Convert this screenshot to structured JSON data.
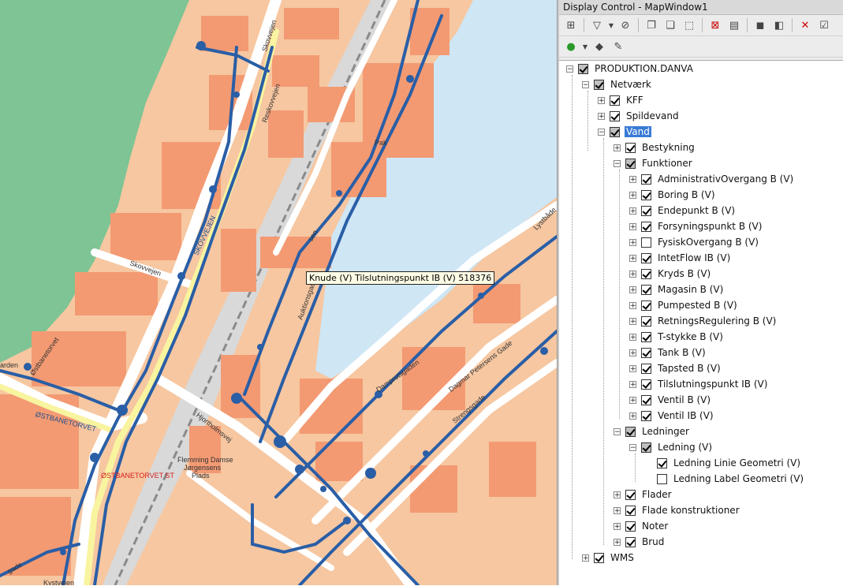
{
  "window": {
    "title": "Display Control - MapWindow1"
  },
  "colors": {
    "water": "#cfe6f5",
    "park": "#7ec494",
    "building": "#f39a73",
    "road": "#ffffff",
    "highway": "#f8f4a0",
    "pipe": "#2a5ea6",
    "rail": "#d9d9d9",
    "select": "#3a7bd5"
  },
  "toolbar": {
    "row1": [
      "tree-layout-icon",
      "filter-icon",
      "filter-dropdown-icon",
      "filter-clear-icon",
      "copy-layer-icon",
      "paste-layer-icon",
      "select-layer-icon",
      "zoom-extent-icon",
      "properties-icon",
      "group-icon",
      "ungroup-icon",
      "remove-layer-icon",
      "settings-icon"
    ],
    "row2": [
      "add-layer-icon",
      "add-dropdown-icon",
      "layer-style-icon",
      "edit-layer-icon"
    ]
  },
  "map": {
    "tooltip": "Knude (V) Tilslutningspunkt IB (V) 518376",
    "labels": [
      {
        "id": "skovvejen1",
        "text": "Skovvejen"
      },
      {
        "id": "reskovvejen",
        "text": "Reskovvejen"
      },
      {
        "id": "skovvejen2",
        "text": "SKOVVEJEN"
      },
      {
        "id": "skovvejen3",
        "text": "Skovvejen"
      },
      {
        "id": "ostbanetorvet1",
        "text": "Østbanetorvet"
      },
      {
        "id": "ostbanetorvet2",
        "text": "ØSTBANETORVET"
      },
      {
        "id": "ostbanetorvetst",
        "text": "ØSTBANETORVET ST"
      },
      {
        "id": "hjortholmsvej",
        "text": "Hjortholmsvej"
      },
      {
        "id": "auktionsgaden",
        "text": "Auktionsgaden"
      },
      {
        "id": "flemming",
        "text": "Flemming Damse"
      },
      {
        "id": "jorgensens",
        "text": "Jørgensens"
      },
      {
        "id": "plads",
        "text": "Plads"
      },
      {
        "id": "damprotsgaden",
        "text": "Damprotsgaden"
      },
      {
        "id": "dagmar",
        "text": "Dagmar Petersens Gade"
      },
      {
        "id": "strengrade",
        "text": "Strengsgade"
      },
      {
        "id": "lystbade",
        "text": "Lystbåde"
      },
      {
        "id": "garden",
        "text": "arden"
      },
      {
        "id": "kystvejen",
        "text": "Kystvejen"
      },
      {
        "id": "gade",
        "text": "gade"
      },
      {
        "id": "pak",
        "text": "Pak"
      },
      {
        "id": "sen",
        "text": "sen"
      }
    ]
  },
  "tree": {
    "root": "PRODUKTION.DANVA",
    "netvaerk": "Netværk",
    "kff": "KFF",
    "spildevand": "Spildevand",
    "vand": "Vand",
    "bestykning": "Bestykning",
    "funktioner": "Funktioner",
    "functions": [
      {
        "label": "AdministrativOvergang B (V)",
        "checked": true
      },
      {
        "label": "Boring B (V)",
        "checked": true
      },
      {
        "label": "Endepunkt B (V)",
        "checked": true
      },
      {
        "label": "Forsyningspunkt B (V)",
        "checked": true
      },
      {
        "label": "FysiskOvergang B (V)",
        "checked": false
      },
      {
        "label": "IntetFlow IB (V)",
        "checked": true
      },
      {
        "label": "Kryds B (V)",
        "checked": true
      },
      {
        "label": "Magasin B (V)",
        "checked": true
      },
      {
        "label": "Pumpested B (V)",
        "checked": true
      },
      {
        "label": "RetningsRegulering B (V)",
        "checked": true
      },
      {
        "label": "T-stykke B (V)",
        "checked": true
      },
      {
        "label": "Tank B (V)",
        "checked": true
      },
      {
        "label": "Tapsted B (V)",
        "checked": true
      },
      {
        "label": "Tilslutningspunkt IB (V)",
        "checked": true
      },
      {
        "label": "Ventil B (V)",
        "checked": true
      },
      {
        "label": "Ventil IB (V)",
        "checked": true
      }
    ],
    "ledninger": "Ledninger",
    "ledning": "Ledning (V)",
    "linie_geometri": "Ledning Linie Geometri (V)",
    "label_geometri": "Ledning Label Geometri (V)",
    "flader": "Flader",
    "flade_konstruktioner": "Flade konstruktioner",
    "noter": "Noter",
    "brud": "Brud",
    "wms": "WMS"
  }
}
